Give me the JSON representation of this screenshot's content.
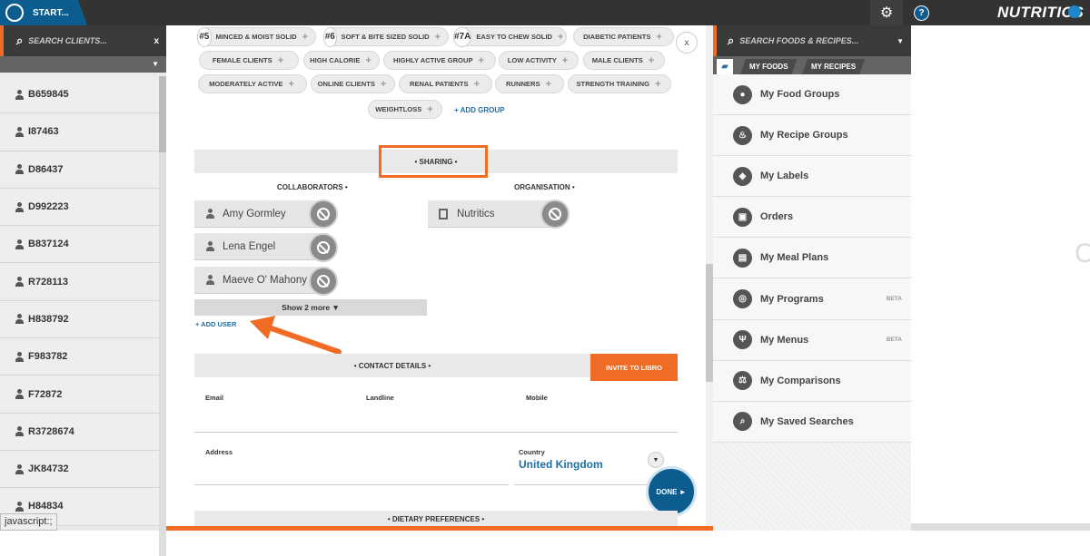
{
  "topbar": {
    "start_label": "START...",
    "brand": "NUTRITICS",
    "help": "?",
    "gear": "⚙"
  },
  "left": {
    "search_placeholder": "SEARCH CLIENTS...",
    "close": "x",
    "filter_arrow": "▼",
    "clients": [
      "B659845",
      "I87463",
      "D86437",
      "D992223",
      "B837124",
      "R728113",
      "H838792",
      "F983782",
      "F72872",
      "R3728674",
      "JK84732",
      "H84834"
    ],
    "status_text": "javascript:;"
  },
  "groups": {
    "chips": [
      {
        "num": "#5",
        "label": "MINCED & MOIST SOLID"
      },
      {
        "num": "#6",
        "label": "SOFT & BITE SIZED SOLID"
      },
      {
        "num": "#7A",
        "label": "EASY TO CHEW SOLID"
      },
      {
        "num": "",
        "label": "DIABETIC PATIENTS"
      },
      {
        "num": "",
        "label": "FEMALE CLIENTS"
      },
      {
        "num": "",
        "label": "HIGH CALORIE"
      },
      {
        "num": "",
        "label": "HIGHLY ACTIVE GROUP"
      },
      {
        "num": "",
        "label": "LOW ACTIVITY"
      },
      {
        "num": "",
        "label": "MALE CLIENTS"
      },
      {
        "num": "",
        "label": "MODERATELY ACTIVE"
      },
      {
        "num": "",
        "label": "ONLINE CLIENTS"
      },
      {
        "num": "",
        "label": "RENAL PATIENTS"
      },
      {
        "num": "",
        "label": "RUNNERS"
      },
      {
        "num": "",
        "label": "STRENGTH TRAINING"
      },
      {
        "num": "",
        "label": "WEIGHTLOSS"
      }
    ],
    "close": "x",
    "add_group": "+ ADD GROUP"
  },
  "sharing": {
    "title": "• SHARING •",
    "collaborators_head": "COLLABORATORS •",
    "organisation_head": "ORGANISATION •",
    "collaborators": [
      "Amy Gormley",
      "Lena Engel",
      "Maeve O' Mahony"
    ],
    "organisation": "Nutritics",
    "show_more": "Show 2 more ▼",
    "add_user": "+ ADD USER"
  },
  "contact": {
    "title": "• CONTACT DETAILS •",
    "invite": "INVITE TO LIBRO",
    "email_label": "Email",
    "landline_label": "Landline",
    "mobile_label": "Mobile",
    "address_label": "Address",
    "country_label": "Country",
    "country_value": "United Kingdom",
    "done": "DONE ►",
    "dietary": "• DIETARY PREFERENCES •"
  },
  "right": {
    "search_placeholder": "SEARCH FOODS & RECIPES...",
    "tabs": [
      "MY FOODS",
      "MY RECIPES"
    ],
    "menu": [
      {
        "label": "My Food Groups",
        "icon": "apple-icon",
        "glyph": "●",
        "beta": ""
      },
      {
        "label": "My Recipe Groups",
        "icon": "chef-hat-icon",
        "glyph": "♨",
        "beta": ""
      },
      {
        "label": "My Labels",
        "icon": "tag-icon",
        "glyph": "◈",
        "beta": ""
      },
      {
        "label": "Orders",
        "icon": "orders-icon",
        "glyph": "▣",
        "beta": ""
      },
      {
        "label": "My Meal Plans",
        "icon": "meal-plan-icon",
        "glyph": "▤",
        "beta": ""
      },
      {
        "label": "My Programs",
        "icon": "programs-icon",
        "glyph": "◎",
        "beta": "BETA"
      },
      {
        "label": "My Menus",
        "icon": "cutlery-icon",
        "glyph": "Ψ",
        "beta": "BETA"
      },
      {
        "label": "My Comparisons",
        "icon": "scales-icon",
        "glyph": "⚖",
        "beta": ""
      },
      {
        "label": "My Saved Searches",
        "icon": "saved-search-icon",
        "glyph": "⌕",
        "beta": ""
      }
    ]
  },
  "colors": {
    "accent": "#f06b23",
    "brand": "#0d5c8f",
    "link": "#1d6fa6"
  }
}
